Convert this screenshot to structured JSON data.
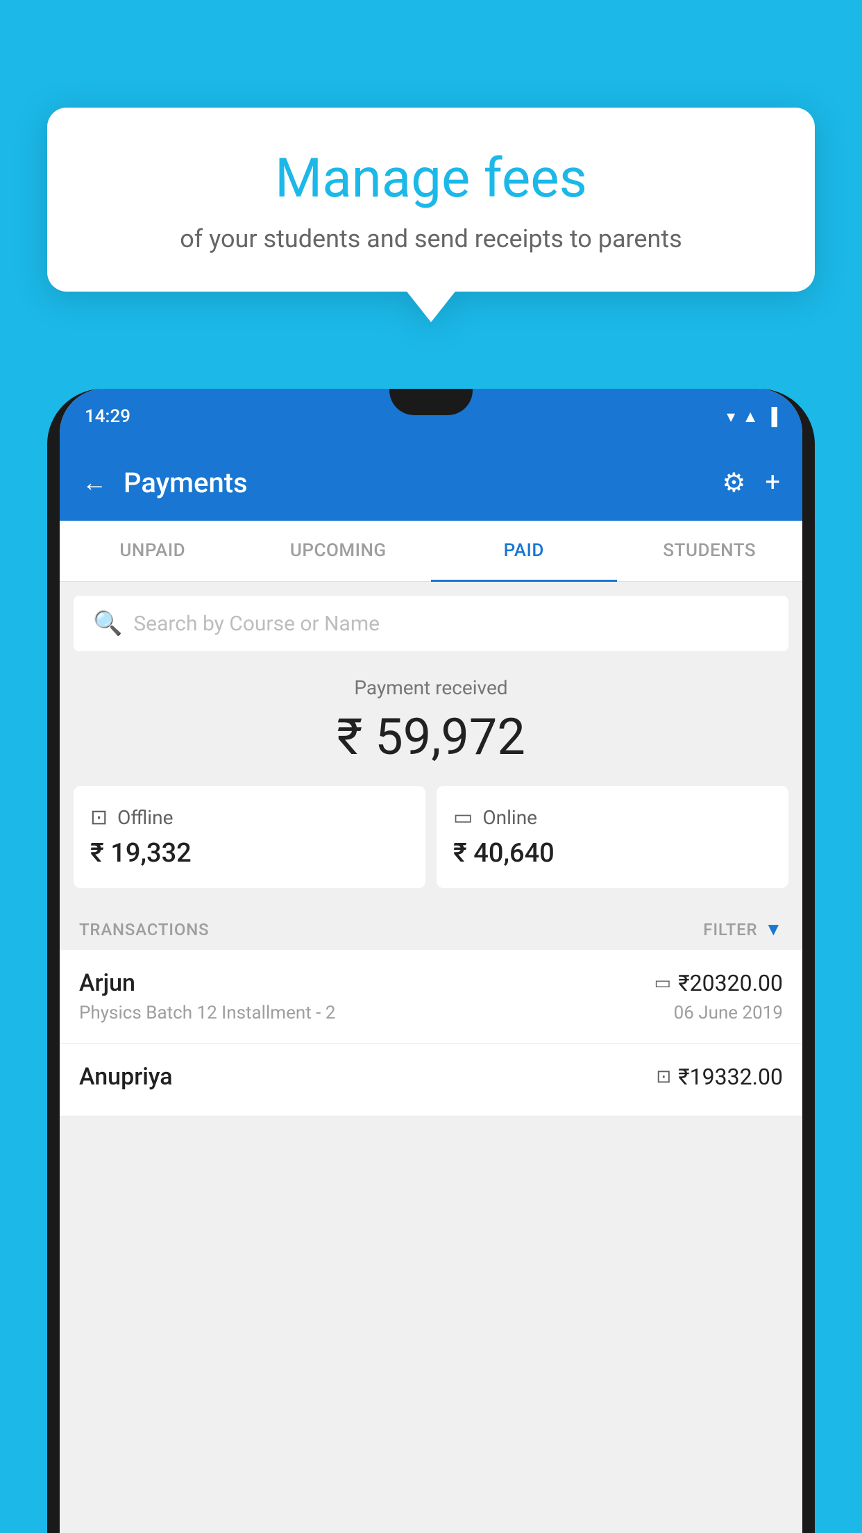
{
  "background_color": "#1BB8E8",
  "speech_bubble": {
    "title": "Manage fees",
    "subtitle": "of your students and send receipts to parents"
  },
  "phone": {
    "status_bar": {
      "time": "14:29",
      "wifi_icon": "▼",
      "signal_icon": "▲",
      "battery_icon": "▐"
    },
    "app_bar": {
      "back_label": "←",
      "title": "Payments",
      "settings_label": "⚙",
      "add_label": "+"
    },
    "tabs": [
      {
        "label": "UNPAID",
        "active": false
      },
      {
        "label": "UPCOMING",
        "active": false
      },
      {
        "label": "PAID",
        "active": true
      },
      {
        "label": "STUDENTS",
        "active": false
      }
    ],
    "search": {
      "placeholder": "Search by Course or Name"
    },
    "payment_received": {
      "label": "Payment received",
      "amount": "₹ 59,972"
    },
    "payment_cards": [
      {
        "type": "Offline",
        "amount": "₹ 19,332",
        "icon": "▣"
      },
      {
        "type": "Online",
        "amount": "₹ 40,640",
        "icon": "▬"
      }
    ],
    "transactions": {
      "header_label": "TRANSACTIONS",
      "filter_label": "FILTER",
      "rows": [
        {
          "name": "Arjun",
          "description": "Physics Batch 12 Installment - 2",
          "amount": "₹20320.00",
          "date": "06 June 2019",
          "type_icon": "▬"
        },
        {
          "name": "Anupriya",
          "description": "",
          "amount": "₹19332.00",
          "date": "",
          "type_icon": "▣"
        }
      ]
    }
  }
}
